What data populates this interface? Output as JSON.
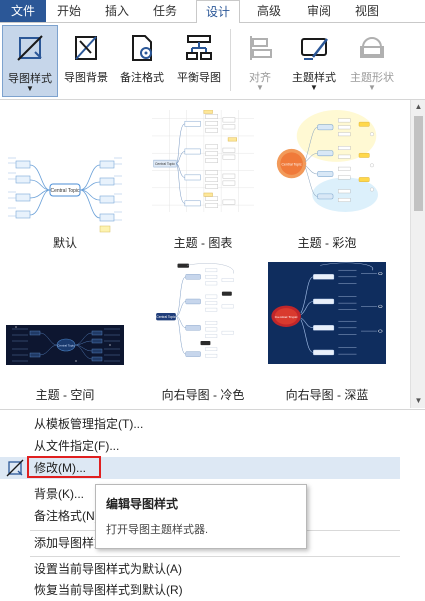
{
  "tabs": [
    "文件",
    "开始",
    "插入",
    "任务",
    "设计",
    "高级",
    "审阅",
    "视图"
  ],
  "ribbon": {
    "map_style": "导图样式",
    "map_background": "导图背景",
    "note_format": "备注格式",
    "balance_map": "平衡导图",
    "align": "对齐",
    "topic_style": "主题样式",
    "topic_shape": "主题形状"
  },
  "gallery": [
    {
      "caption": "默认"
    },
    {
      "caption": "主题 - 图表"
    },
    {
      "caption": "主题 - 彩泡"
    },
    {
      "caption": "主题 - 空间"
    },
    {
      "caption": "向右导图 - 冷色"
    },
    {
      "caption": "向右导图 - 深蓝"
    }
  ],
  "thumb_text": {
    "central": "Central Topic",
    "main": "Main Topic",
    "sub": "Subtopic"
  },
  "menu": {
    "from_template": "从模板管理指定(T)...",
    "from_file": "从文件指定(F)...",
    "modify": "修改(M)...",
    "background": "背景(K)...",
    "note_format": "备注格式(N)",
    "add_style": "添加导图样式",
    "set_default": "设置当前导图样式为默认(A)",
    "restore_default": "恢复当前导图样式到默认(R)"
  },
  "tooltip": {
    "title": "编辑导图样式",
    "body": "打开导图主题样式器."
  },
  "colors": {
    "accent": "#2b5797",
    "highlight": "#dde8f4",
    "selected": "#c6d6ea",
    "red_box": "#e02020"
  }
}
